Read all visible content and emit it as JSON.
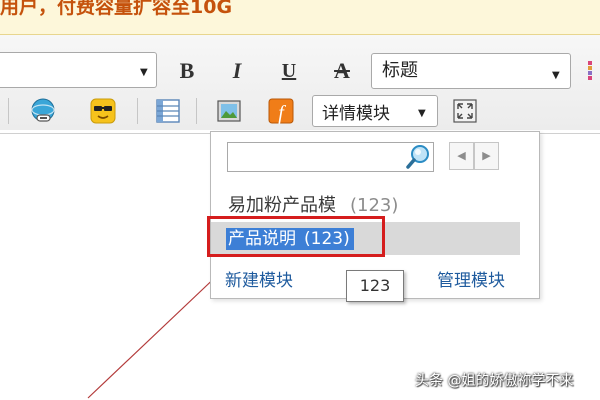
{
  "banner": {
    "text": "用户，付费容量扩容至10G"
  },
  "toolbar": {
    "bold": "B",
    "italic": "I",
    "underline": "U",
    "strikethrough": "A",
    "heading_select": "标题",
    "template_select": "详情模块"
  },
  "template_dropdown": {
    "search_placeholder": "",
    "pager_prev": "◀",
    "pager_next": "▶",
    "items": [
      {
        "name": "易加粉产品模",
        "count": "(123)"
      },
      {
        "name": "产品说明",
        "count": "(123)",
        "selected": true
      }
    ],
    "new_template": "新建模块",
    "manage_templates": "管理模块"
  },
  "tooltip": {
    "text": "123"
  },
  "watermark": {
    "text": "头条 @姐的娇傲祢学不来"
  },
  "colors": {
    "banner_text": "#c5520c",
    "selection_highlight": "#3d7fd6",
    "callout_red": "#d51d1d",
    "link_blue": "#1f5b9e"
  }
}
